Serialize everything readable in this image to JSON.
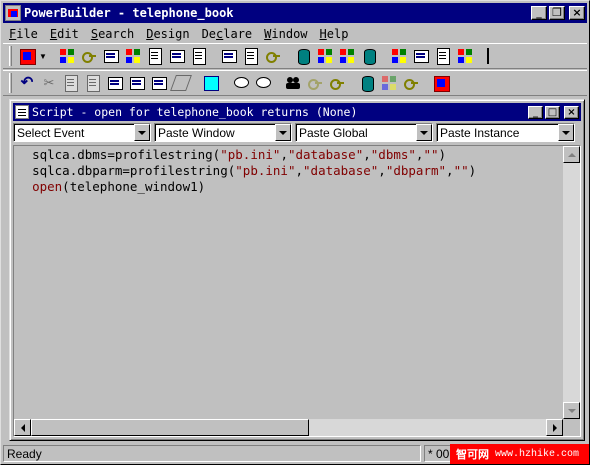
{
  "app": {
    "title": "PowerBuilder - telephone_book"
  },
  "menu": [
    {
      "label": "File",
      "key": "F",
      "rest": "ile"
    },
    {
      "label": "Edit",
      "key": "E",
      "rest": "dit"
    },
    {
      "label": "Search",
      "key": "S",
      "rest": "earch"
    },
    {
      "label": "Design",
      "key": "D",
      "rest": "esign"
    },
    {
      "label": "Declare",
      "key": "c",
      "prefix": "De",
      "rest": "lare"
    },
    {
      "label": "Window",
      "key": "W",
      "rest": "indow"
    },
    {
      "label": "Help",
      "key": "H",
      "rest": "elp"
    }
  ],
  "script_window": {
    "title": "Script - open for telephone_book returns (None)",
    "select_event": "Select Event",
    "paste_window": "Paste Window",
    "paste_global": "Paste Global",
    "paste_instance": "Paste Instance"
  },
  "code_lines": [
    [
      {
        "t": "sqlca.dbms=profilestring(",
        "c": "plain"
      },
      {
        "t": "\"pb.ini\"",
        "c": "str"
      },
      {
        "t": ",",
        "c": "plain"
      },
      {
        "t": "\"database\"",
        "c": "str"
      },
      {
        "t": ",",
        "c": "plain"
      },
      {
        "t": "\"dbms\"",
        "c": "str"
      },
      {
        "t": ",",
        "c": "plain"
      },
      {
        "t": "\"\"",
        "c": "str"
      },
      {
        "t": ")",
        "c": "plain"
      }
    ],
    [
      {
        "t": "sqlca.dbparm=profilestring(",
        "c": "plain"
      },
      {
        "t": "\"pb.ini\"",
        "c": "str"
      },
      {
        "t": ",",
        "c": "plain"
      },
      {
        "t": "\"database\"",
        "c": "str"
      },
      {
        "t": ",",
        "c": "plain"
      },
      {
        "t": "\"dbparm\"",
        "c": "str"
      },
      {
        "t": ",",
        "c": "plain"
      },
      {
        "t": "\"\"",
        "c": "str"
      },
      {
        "t": ")",
        "c": "plain"
      }
    ],
    [
      {
        "t": "open",
        "c": "kw"
      },
      {
        "t": "(telephone_window1)",
        "c": "plain"
      }
    ]
  ],
  "status": {
    "text": "Ready",
    "position": "* 00"
  },
  "watermark": {
    "brand": "智可网",
    "url": "www.hzhike.com"
  },
  "colors": {
    "titlebar": "#000080",
    "chrome": "#c0c0c0",
    "string_literal": "#800000"
  }
}
